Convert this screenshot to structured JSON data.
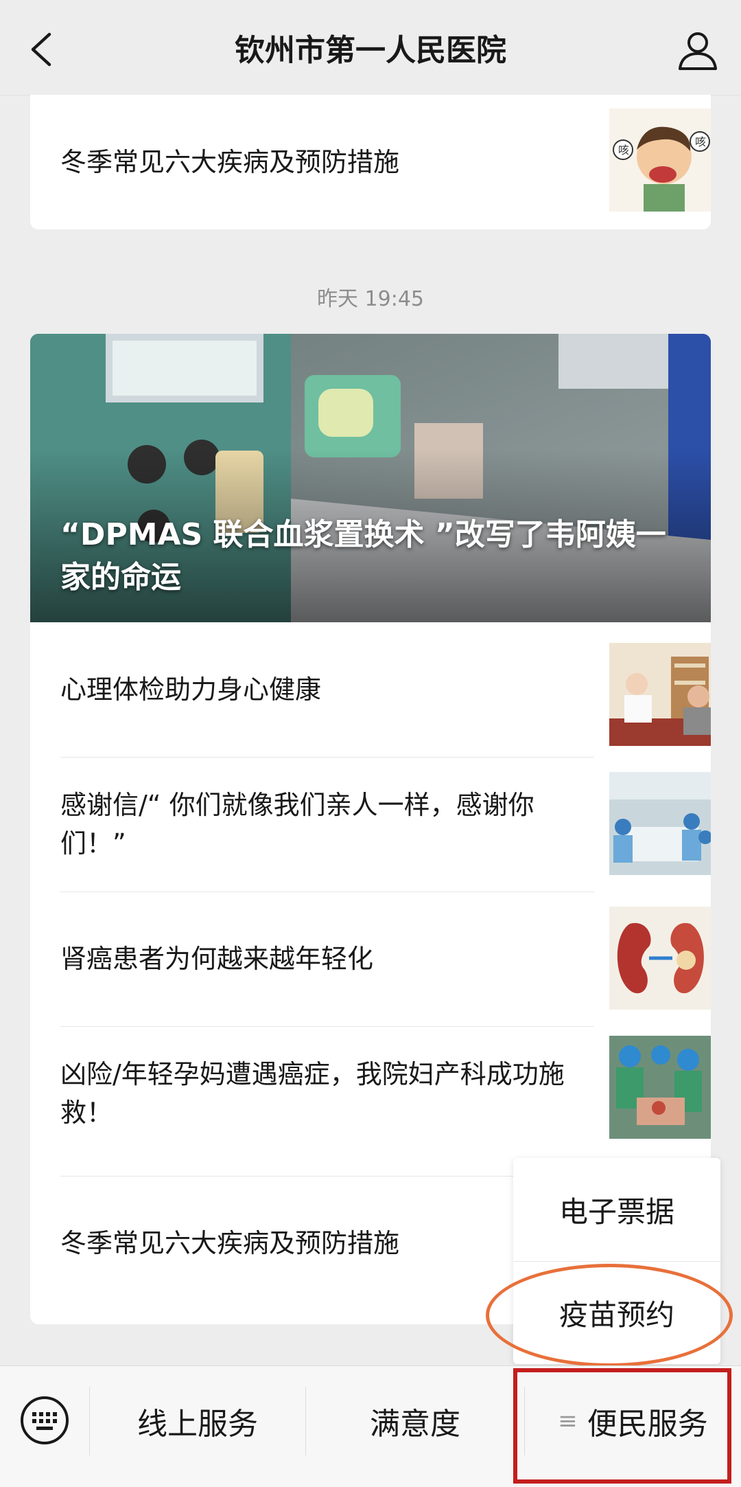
{
  "header": {
    "title": "钦州市第一人民医院",
    "back_icon": "chevron-left-icon",
    "profile_icon": "user-icon"
  },
  "top_card": {
    "title": "冬季常见六大疾病及预防措施"
  },
  "timestamp": "昨天 19:45",
  "main_card": {
    "hero_title": "“DPMAS 联合血浆置换术 ”改写了韦阿姨一家的命运",
    "articles": [
      {
        "title": "心理体检助力身心健康"
      },
      {
        "title": "感谢信/“ 你们就像我们亲人一样，感谢你们！”"
      },
      {
        "title": "肾癌患者为何越来越年轻化"
      },
      {
        "title": "凶险/年轻孕妈遭遇癌症，我院妇产科成功施救！"
      },
      {
        "title": "冬季常见六大疾病及预防措施"
      }
    ]
  },
  "popup_menu": {
    "items": [
      "电子票据",
      "疫苗预约"
    ]
  },
  "bottom_bar": {
    "keyboard_icon": "keyboard-icon",
    "buttons": [
      "线上服务",
      "满意度",
      "便民服务"
    ],
    "menu_icon": "≡"
  },
  "colors": {
    "highlight_ring": "#e8703a",
    "highlight_box": "#c41e1e"
  }
}
